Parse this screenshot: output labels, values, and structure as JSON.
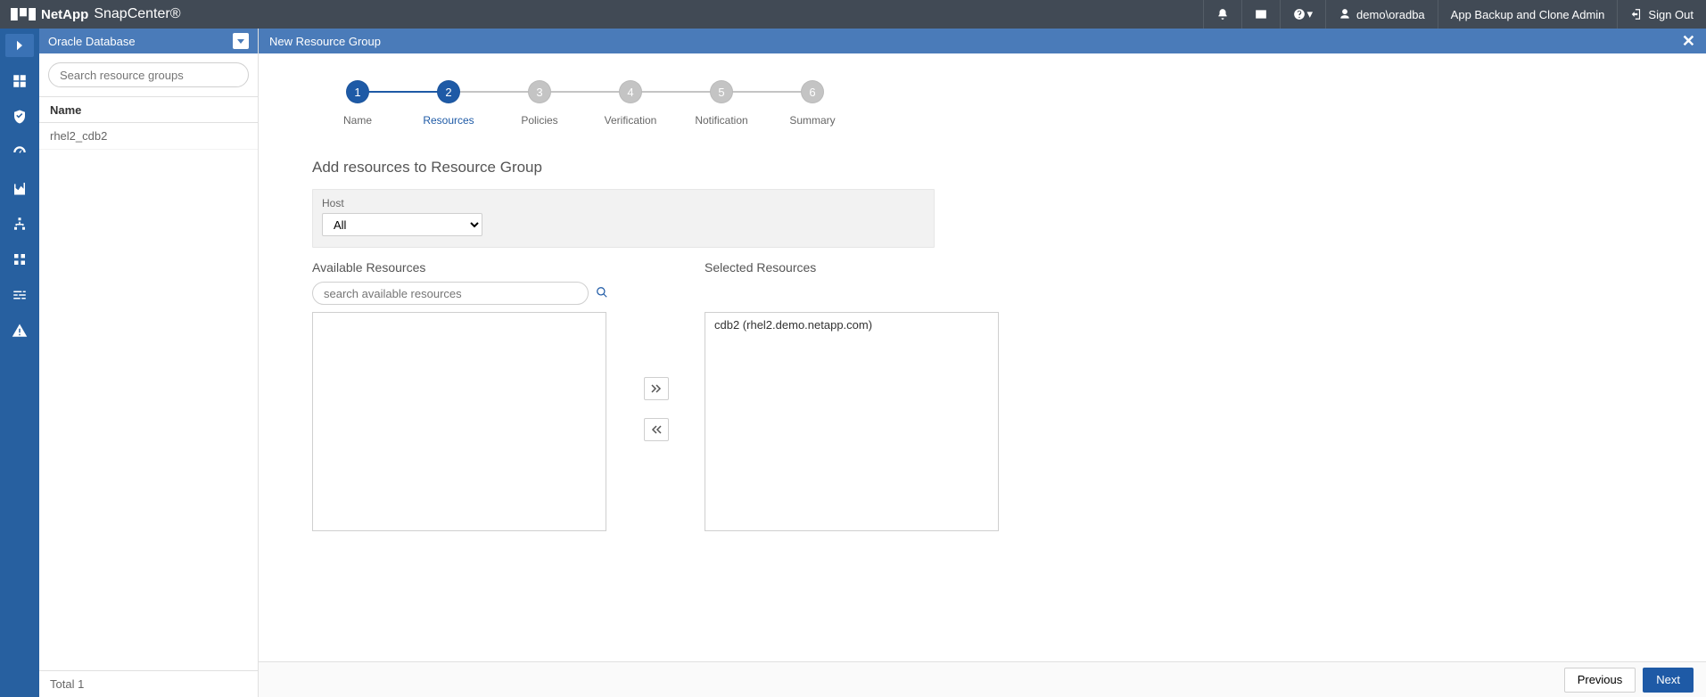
{
  "brand": {
    "company": "NetApp",
    "product": "SnapCenter®"
  },
  "top": {
    "user": "demo\\oradba",
    "role": "App Backup and Clone Admin",
    "signout": "Sign Out"
  },
  "sidebar2": {
    "title": "Oracle Database",
    "search_placeholder": "Search resource groups",
    "col_name": "Name",
    "rows": [
      "rhel2_cdb2"
    ],
    "total_label": "Total 1"
  },
  "main": {
    "title": "New Resource Group",
    "steps": [
      {
        "num": "1",
        "label": "Name"
      },
      {
        "num": "2",
        "label": "Resources"
      },
      {
        "num": "3",
        "label": "Policies"
      },
      {
        "num": "4",
        "label": "Verification"
      },
      {
        "num": "5",
        "label": "Notification"
      },
      {
        "num": "6",
        "label": "Summary"
      }
    ],
    "section_title": "Add resources to Resource Group",
    "host_label": "Host",
    "host_value": "All",
    "available_title": "Available Resources",
    "selected_title": "Selected Resources",
    "search_available_placeholder": "search available resources",
    "selected_items": [
      "cdb2 (rhel2.demo.netapp.com)"
    ],
    "move_right": ">>",
    "move_left": "<<",
    "prev": "Previous",
    "next": "Next"
  }
}
